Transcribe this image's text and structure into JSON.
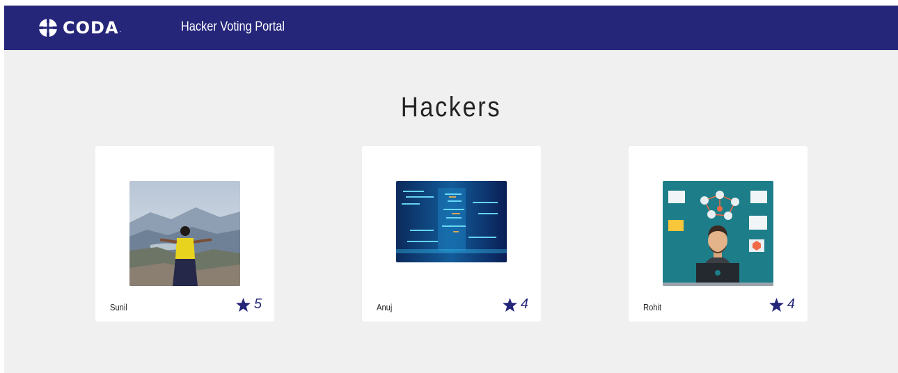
{
  "navbar": {
    "brand": "CODA",
    "portal_title": "Hacker Voting Portal",
    "logo_icon": "crosshair-globe-icon",
    "bg_color": "#25267a"
  },
  "page": {
    "heading": "Hackers",
    "bg_color": "#f0f0f0"
  },
  "hackers": [
    {
      "name": "Sunil",
      "rating": "5",
      "photo": "mountain-landscape-photo",
      "rating_icon": "star-icon"
    },
    {
      "name": "Anuj",
      "rating": "4",
      "photo": "code-screen-photo",
      "rating_icon": "star-icon"
    },
    {
      "name": "Rohit",
      "rating": "4",
      "photo": "hacker-illustration",
      "rating_icon": "star-icon"
    }
  ]
}
